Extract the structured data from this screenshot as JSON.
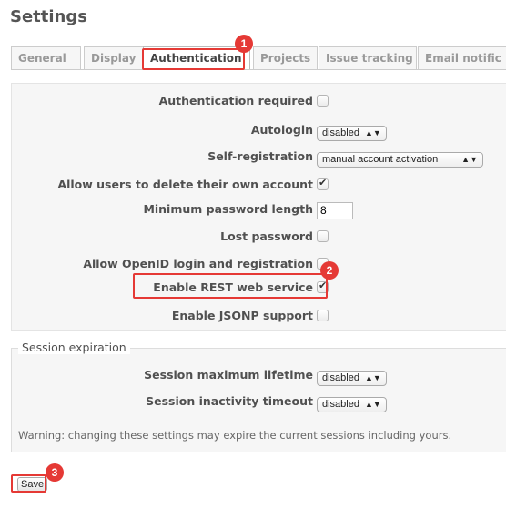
{
  "page": {
    "title": "Settings"
  },
  "tabs": [
    {
      "label": "General"
    },
    {
      "label": "Display"
    },
    {
      "label": "Authentication"
    },
    {
      "label": "Projects"
    },
    {
      "label": "Issue tracking"
    },
    {
      "label": "Email notific"
    }
  ],
  "auth": {
    "authentication_required": {
      "label": "Authentication required",
      "checked": false
    },
    "autologin": {
      "label": "Autologin",
      "value": "disabled"
    },
    "self_registration": {
      "label": "Self-registration",
      "value": "manual account activation"
    },
    "allow_delete_account": {
      "label": "Allow users to delete their own account",
      "checked": true
    },
    "min_password_length": {
      "label": "Minimum password length",
      "value": "8"
    },
    "lost_password": {
      "label": "Lost password",
      "checked": false
    },
    "openid": {
      "label": "Allow OpenID login and registration",
      "checked": false
    },
    "rest_api": {
      "label": "Enable REST web service",
      "checked": true
    },
    "jsonp": {
      "label": "Enable JSONP support",
      "checked": false
    }
  },
  "session": {
    "legend": "Session expiration",
    "max_lifetime": {
      "label": "Session maximum lifetime",
      "value": "disabled"
    },
    "inactivity_timeout": {
      "label": "Session inactivity timeout",
      "value": "disabled"
    },
    "warning": "Warning: changing these settings may expire the current sessions including yours."
  },
  "save_label": "Save",
  "markers": [
    "1",
    "2",
    "3"
  ],
  "colors": {
    "highlight": "#e53935",
    "panel_bg": "#f6f6f6"
  }
}
